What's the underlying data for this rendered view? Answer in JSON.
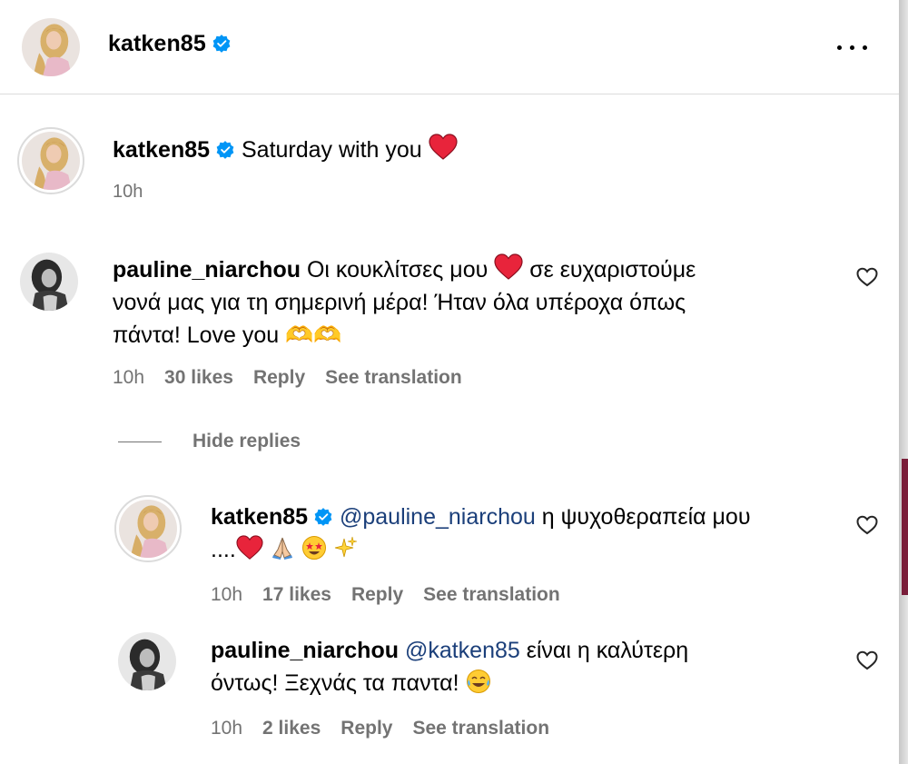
{
  "header": {
    "username": "katken85",
    "more_icon": "more-horizontal-icon"
  },
  "caption": {
    "username": "katken85",
    "text": "Saturday with you",
    "emoji": "red-heart",
    "time": "10h"
  },
  "comments": [
    {
      "username": "pauline_niarchou",
      "text_a": "Οι κουκλίτσες μου",
      "line_1_b": "σε ευχαριστούμε",
      "line_2": "νονά μας για τη σημερινή μέρα! Ήταν όλα υπέροχα όπως",
      "line_3": "πάντα! Love you",
      "trail": "🫶🫶",
      "time": "10h",
      "likes": "30 likes",
      "reply": "Reply",
      "translate": "See translation"
    }
  ],
  "hide_replies": "Hide replies",
  "replies": [
    {
      "username": "katken85",
      "mention": "@pauline_niarchou",
      "text_1": "η ψυχοθεραπεία μου",
      "text_2": "....",
      "time": "10h",
      "likes": "17 likes",
      "reply": "Reply",
      "translate": "See translation"
    },
    {
      "username": "pauline_niarchou",
      "mention": "@katken85",
      "text_1": "είναι η καλύτερη",
      "text_2": "όντως! Ξεχνάς τα παντα!",
      "time": "10h",
      "likes": "2 likes",
      "reply": "Reply",
      "translate": "See translation"
    }
  ],
  "colors": {
    "secondary": "#737373",
    "verified": "#0095f6",
    "mention": "#1b3f7a",
    "heart": "#e0245e"
  }
}
